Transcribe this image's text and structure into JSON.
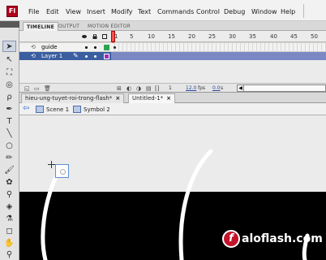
{
  "app": {
    "logo_text": "Fl"
  },
  "menu": [
    "File",
    "Edit",
    "View",
    "Insert",
    "Modify",
    "Text",
    "Commands",
    "Control",
    "Debug",
    "Window",
    "Help"
  ],
  "panel_tabs": [
    "TIMELINE",
    "OUTPUT",
    "MOTION EDITOR"
  ],
  "ruler": [
    "1",
    "5",
    "10",
    "15",
    "20",
    "25",
    "30",
    "35",
    "40",
    "45",
    "50"
  ],
  "layers": [
    {
      "name": "guide",
      "selected": false,
      "outline_color": "#2ea44f"
    },
    {
      "name": "Layer 1",
      "selected": true,
      "outline_color": "#9b2fb8"
    }
  ],
  "footer": {
    "frame": "1",
    "fps": "12.0",
    "fps_unit": "fps",
    "time": "0.0",
    "time_unit": "s"
  },
  "doc_tabs": [
    {
      "label": "hieu-ung-tuyet-roi-trong-flash*",
      "active": false
    },
    {
      "label": "Untitled-1*",
      "active": true
    }
  ],
  "breadcrumb": {
    "scene": "Scene 1",
    "symbol": "Symbol 2"
  },
  "watermark": {
    "logo_letter": "f",
    "text": "aloflash.com"
  },
  "colors": {
    "selected_layer": "#3a5ea0",
    "playhead": "#d40000",
    "stage_dark": "#000000"
  }
}
